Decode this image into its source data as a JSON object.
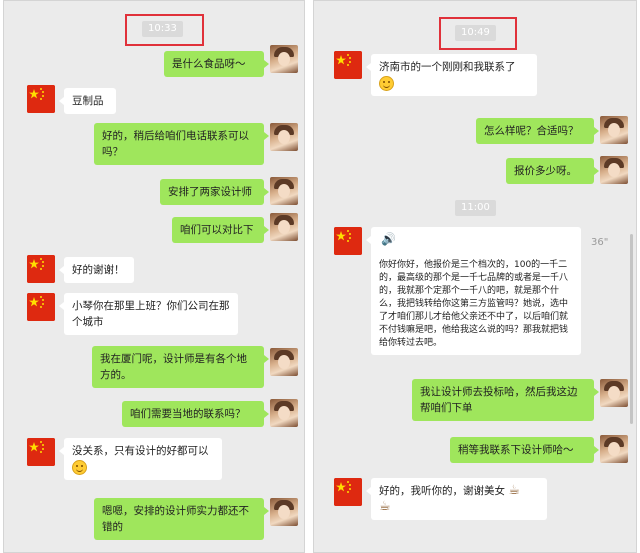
{
  "left": {
    "time": "10:33",
    "messages": [
      {
        "text": "是什么食品呀～"
      },
      {
        "text": "豆制品"
      },
      {
        "text": "好的，稍后给咱们电话联系可以吗？"
      },
      {
        "text": "安排了两家设计师"
      },
      {
        "text": "咱们可以对比下"
      },
      {
        "text": "好的谢谢！"
      },
      {
        "text": "小琴你在那里上班？你们公司在那个城市"
      },
      {
        "text": "我在厦门呢，设计师是有各个地方的。"
      },
      {
        "text": "咱们需要当地的联系吗？"
      },
      {
        "text": "没关系，只有设计的好都可以"
      },
      {
        "text": "嗯嗯，安排的设计师实力都还不错的"
      }
    ]
  },
  "right": {
    "time1": "10:49",
    "time2": "11:00",
    "messages": [
      {
        "text": "济南市的一个刚刚和我联系了"
      },
      {
        "text": "怎么样呢？合适吗？"
      },
      {
        "text": "报价多少呀。"
      },
      {
        "text": "你好你好，他报价是三个档次的，100的一千二的，最高级的那个是一千七品牌的或者是一千八的，我就那个定那个一千八的吧，就是那个什么，我把钱转给你这第三方监管吗？她说，选中了才咱们那儿才给他父亲还不中了，以后咱们就不付钱嘛是吧，他给我这么说的吗？那我就把钱给你转过去吧。"
      },
      {
        "text": "我让设计师去投标哈，然后我这边帮咱们下单"
      },
      {
        "text": "稍等我联系下设计师哈～"
      },
      {
        "text": "好的，我听你的，谢谢美女"
      }
    ],
    "voice_duration": "36\""
  },
  "icons": {
    "flag": "china-flag-avatar",
    "user": "user-photo-avatar",
    "emoji": "smile-emoji",
    "cup": "coffee-cup-emoji",
    "voice": "voice-icon"
  },
  "colors": {
    "me_bubble": "#9fe65c",
    "them_bubble": "#ffffff",
    "highlight": "#e0313a"
  }
}
